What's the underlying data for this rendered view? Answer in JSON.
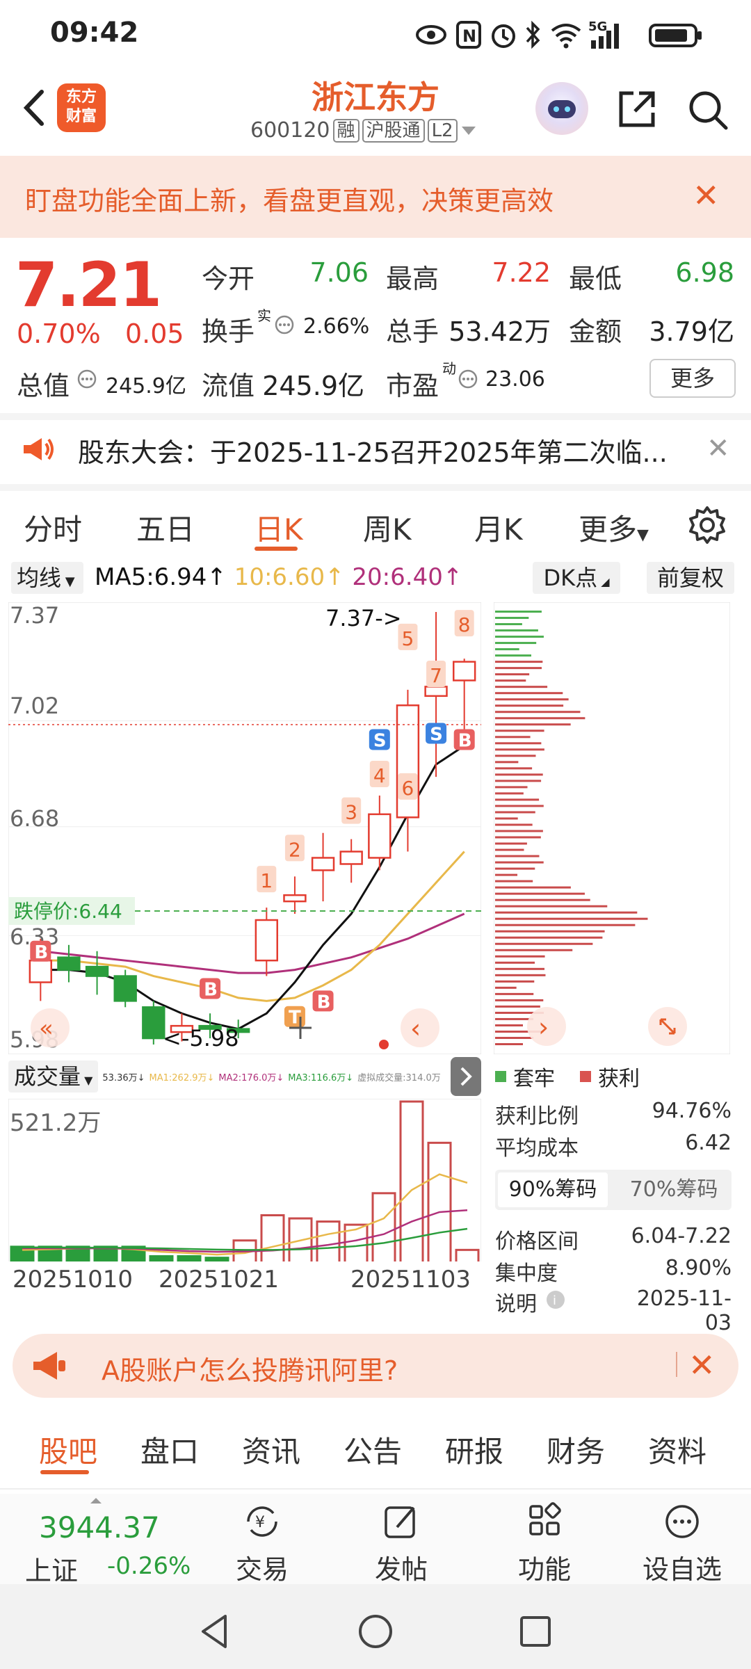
{
  "status_bar": {
    "time": "09:42",
    "network": "5G"
  },
  "header": {
    "logo": {
      "line1": "东方",
      "line2": "财富"
    },
    "stock_name": "浙江东方",
    "stock_code": "600120",
    "tags": [
      "融",
      "沪股通",
      "L2"
    ]
  },
  "banner": {
    "text": "盯盘功能全面上新，看盘更直观，决策更高效",
    "close": "✕"
  },
  "quote": {
    "price": "7.21",
    "change_pct": "0.70%",
    "change": "0.05",
    "open_label": "今开",
    "open": "7.06",
    "high_label": "最高",
    "high": "7.22",
    "low_label": "最低",
    "low": "6.98",
    "turnover_label": "换手",
    "turnover_sup": "实",
    "turnover": "2.66%",
    "volume_label": "总手",
    "volume": "53.42万",
    "amount_label": "金额",
    "amount": "3.79亿",
    "mktcap_label": "总值",
    "mktcap": "245.9亿",
    "float_label": "流值",
    "float": "245.9亿",
    "pe_label": "市盈",
    "pe_sup": "动",
    "pe": "23.06",
    "more": "更多"
  },
  "notice": {
    "text": "股东大会：于2025-11-25召开2025年第二次临...",
    "close": "✕"
  },
  "chart_tabs": {
    "items": [
      "分时",
      "五日",
      "日K",
      "周K",
      "月K",
      "更多"
    ],
    "active": "日K"
  },
  "ma_bar": {
    "select": "均线",
    "ma5": "MA5:6.94↑",
    "ma10": "10:6.60↑",
    "ma20": "20:6.40↑",
    "dk": "DK点",
    "adjust": "前复权"
  },
  "colors": {
    "up": "#e33b2f",
    "down": "#2a9d3c",
    "ma5": "#111111",
    "ma10": "#e8b84a",
    "ma20": "#b0307a",
    "accent": "#e55d2b"
  },
  "kchart": {
    "y_labels": [
      "7.37",
      "7.02",
      "6.68",
      "6.33",
      "5.98"
    ],
    "limit_down_label": "跌停价:6.44",
    "max_label": "7.37->",
    "min_label": "<-5.98",
    "signals": [
      "1",
      "2",
      "3",
      "4",
      "5",
      "6",
      "7",
      "8"
    ],
    "markers": {
      "b": "B",
      "s": "S",
      "t": "T"
    }
  },
  "chart_data": {
    "type": "candlestick",
    "title": "",
    "ylim": [
      5.98,
      7.37
    ],
    "candles": [
      {
        "o": 6.18,
        "h": 6.32,
        "l": 6.12,
        "c": 6.25
      },
      {
        "o": 6.26,
        "h": 6.3,
        "l": 6.18,
        "c": 6.22
      },
      {
        "o": 6.23,
        "h": 6.28,
        "l": 6.14,
        "c": 6.2
      },
      {
        "o": 6.2,
        "h": 6.22,
        "l": 6.1,
        "c": 6.12
      },
      {
        "o": 6.1,
        "h": 6.12,
        "l": 5.98,
        "c": 6.0
      },
      {
        "o": 6.02,
        "h": 6.08,
        "l": 5.99,
        "c": 6.04
      },
      {
        "o": 6.04,
        "h": 6.08,
        "l": 6.0,
        "c": 6.03
      },
      {
        "o": 6.03,
        "h": 6.06,
        "l": 6.0,
        "c": 6.02
      },
      {
        "o": 6.25,
        "h": 6.42,
        "l": 6.2,
        "c": 6.38
      },
      {
        "o": 6.44,
        "h": 6.52,
        "l": 6.4,
        "c": 6.46
      },
      {
        "o": 6.54,
        "h": 6.66,
        "l": 6.44,
        "c": 6.58
      },
      {
        "o": 6.56,
        "h": 6.64,
        "l": 6.5,
        "c": 6.6
      },
      {
        "o": 6.58,
        "h": 6.78,
        "l": 6.54,
        "c": 6.72
      },
      {
        "o": 6.71,
        "h": 7.12,
        "l": 6.6,
        "c": 7.07
      },
      {
        "o": 7.1,
        "h": 7.37,
        "l": 6.84,
        "c": 7.13
      },
      {
        "o": 7.15,
        "h": 7.22,
        "l": 6.98,
        "c": 7.21
      }
    ],
    "ma5": [
      6.22,
      6.22,
      6.21,
      6.18,
      6.12,
      6.08,
      6.05,
      6.03,
      6.08,
      6.18,
      6.3,
      6.4,
      6.55,
      6.72,
      6.88,
      6.94
    ],
    "ma10": [
      6.25,
      6.25,
      6.24,
      6.23,
      6.2,
      6.18,
      6.16,
      6.13,
      6.12,
      6.13,
      6.17,
      6.22,
      6.3,
      6.4,
      6.5,
      6.6
    ],
    "ma20": [
      6.28,
      6.27,
      6.26,
      6.25,
      6.24,
      6.23,
      6.22,
      6.21,
      6.21,
      6.22,
      6.24,
      6.26,
      6.29,
      6.32,
      6.36,
      6.4
    ]
  },
  "volume": {
    "select": "成交量",
    "legend": [
      "53.36万↓",
      "MA1:262.9万↓",
      "MA2:176.0万↓",
      "MA3:116.6万↓",
      "虚拟成交量:314.0万"
    ],
    "max_label": "521.2万",
    "dates": [
      "20251010",
      "20251021",
      "20251103"
    ],
    "values": [
      60,
      60,
      60,
      60,
      60,
      30,
      30,
      25,
      80,
      160,
      150,
      140,
      130,
      230,
      521,
      390,
      50
    ]
  },
  "chips": {
    "legend_trapped": "套牢",
    "legend_profit": "获利",
    "profit_ratio_label": "获利比例",
    "profit_ratio": "94.76%",
    "avg_cost_label": "平均成本",
    "avg_cost": "6.42",
    "tab90": "90%筹码",
    "tab70": "70%筹码",
    "range_label": "价格区间",
    "range": "6.04-7.22",
    "concentration_label": "集中度",
    "concentration": "8.90%",
    "note_label": "说明",
    "note": "2025-11-03"
  },
  "ad": {
    "text": "A股账户怎么投腾讯阿里?",
    "close": "✕"
  },
  "bottom_tabs": {
    "items": [
      "股吧",
      "盘口",
      "资讯",
      "公告",
      "研报",
      "财务",
      "资料"
    ],
    "active": "股吧"
  },
  "nav": {
    "index_value": "3944.37",
    "index_name": "上证",
    "index_pct": "-0.26%",
    "items": [
      "交易",
      "发帖",
      "功能",
      "设自选"
    ]
  }
}
